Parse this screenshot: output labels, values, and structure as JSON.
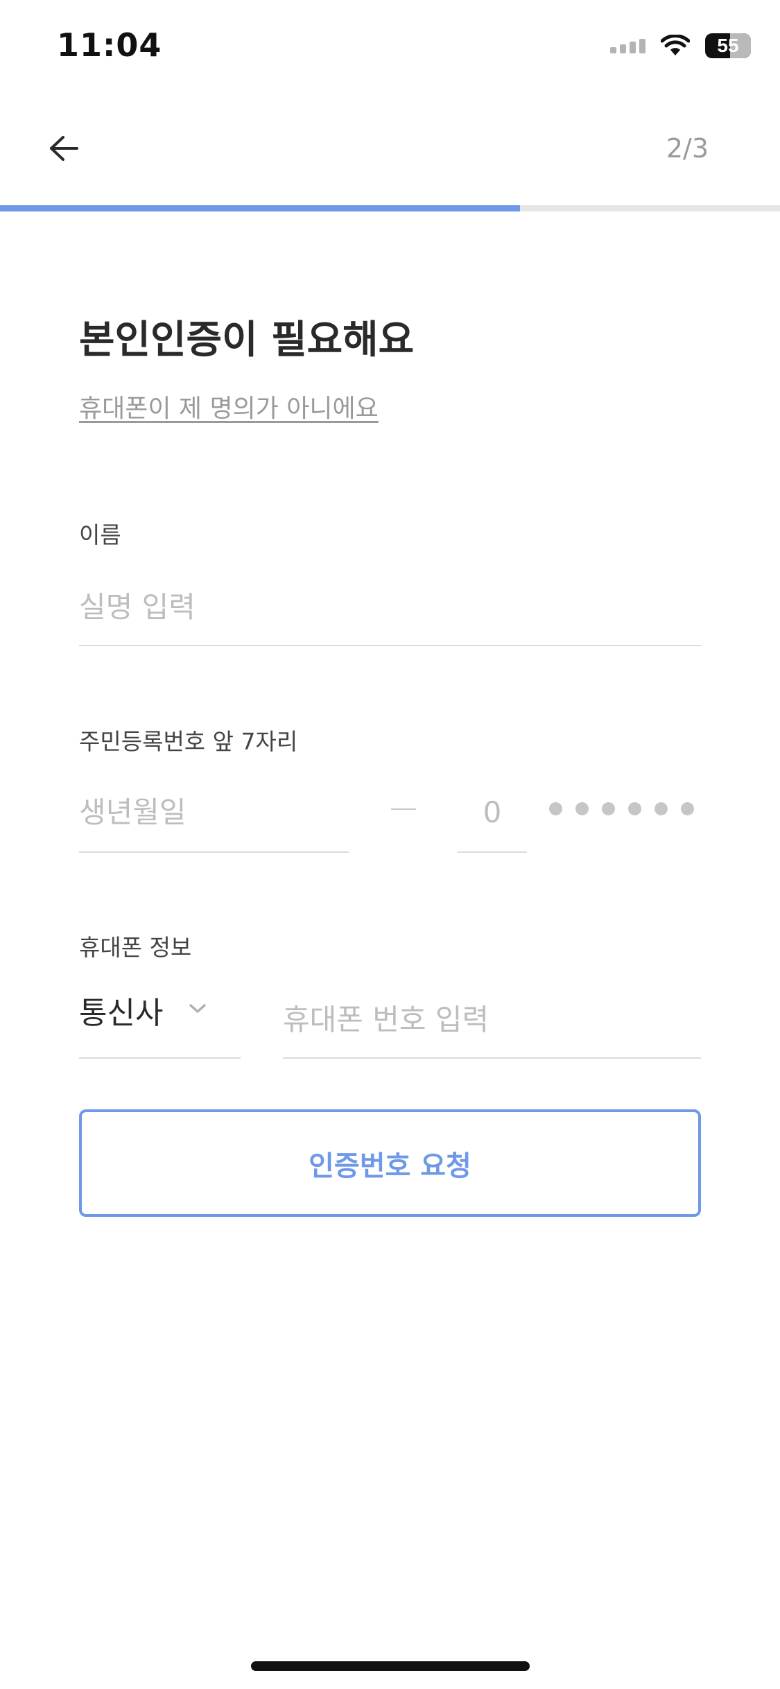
{
  "status_bar": {
    "time": "11:04",
    "battery": "55",
    "signal_icon": "signal-icon",
    "wifi_icon": "wifi-icon",
    "battery_icon": "battery-icon"
  },
  "header": {
    "back_icon": "arrow-left-icon",
    "step": "2/3",
    "progress_fraction": 0.667,
    "progress_color": "#6e98e8"
  },
  "main": {
    "title": "본인인증이 필요해요",
    "not_my_phone_link": "휴대폰이 제 명의가 아니에요",
    "name_field": {
      "label": "이름",
      "placeholder": "실명 입력",
      "value": ""
    },
    "rrn_field": {
      "label": "주민등록번호 앞 7자리",
      "birth_placeholder": "생년월일",
      "separator": "—",
      "gender_placeholder": "0",
      "masked_count": 6
    },
    "phone_field": {
      "label": "휴대폰 정보",
      "carrier_label": "통신사",
      "carrier_icon": "chevron-down-icon",
      "number_placeholder": "휴대폰 번호 입력"
    },
    "request_button": "인증번호 요청"
  },
  "colors": {
    "accent": "#6e98e8",
    "placeholder": "#bdbdbd",
    "divider": "#dcdcdc"
  }
}
